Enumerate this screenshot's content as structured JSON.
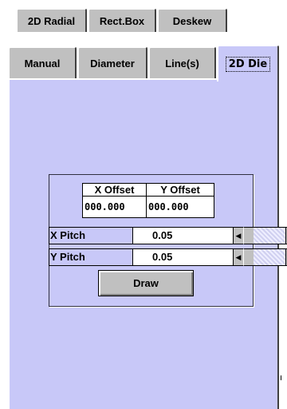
{
  "tabs_row1": [
    {
      "label": "2D Radial"
    },
    {
      "label": "Rect.Box"
    },
    {
      "label": "Deskew"
    }
  ],
  "tabs_row2": [
    {
      "label": "Manual"
    },
    {
      "label": "Diameter"
    },
    {
      "label": "Line(s)"
    },
    {
      "label": "2D Die",
      "selected": true
    }
  ],
  "offset_table": {
    "x_header": "X Offset",
    "y_header": "Y Offset",
    "x_value": "000.000",
    "y_value": "000.000"
  },
  "x_pitch": {
    "label": "X Pitch",
    "value": "0.05"
  },
  "y_pitch": {
    "label": "Y Pitch",
    "value": "0.05"
  },
  "draw_button": {
    "label": "Draw"
  },
  "icons": {
    "scroll_left": "arrow-left-icon",
    "scroll_right": "arrow-right-icon"
  },
  "colors": {
    "panel_bg": "#c8c8f8",
    "tab_bg": "#c0c0c0"
  }
}
